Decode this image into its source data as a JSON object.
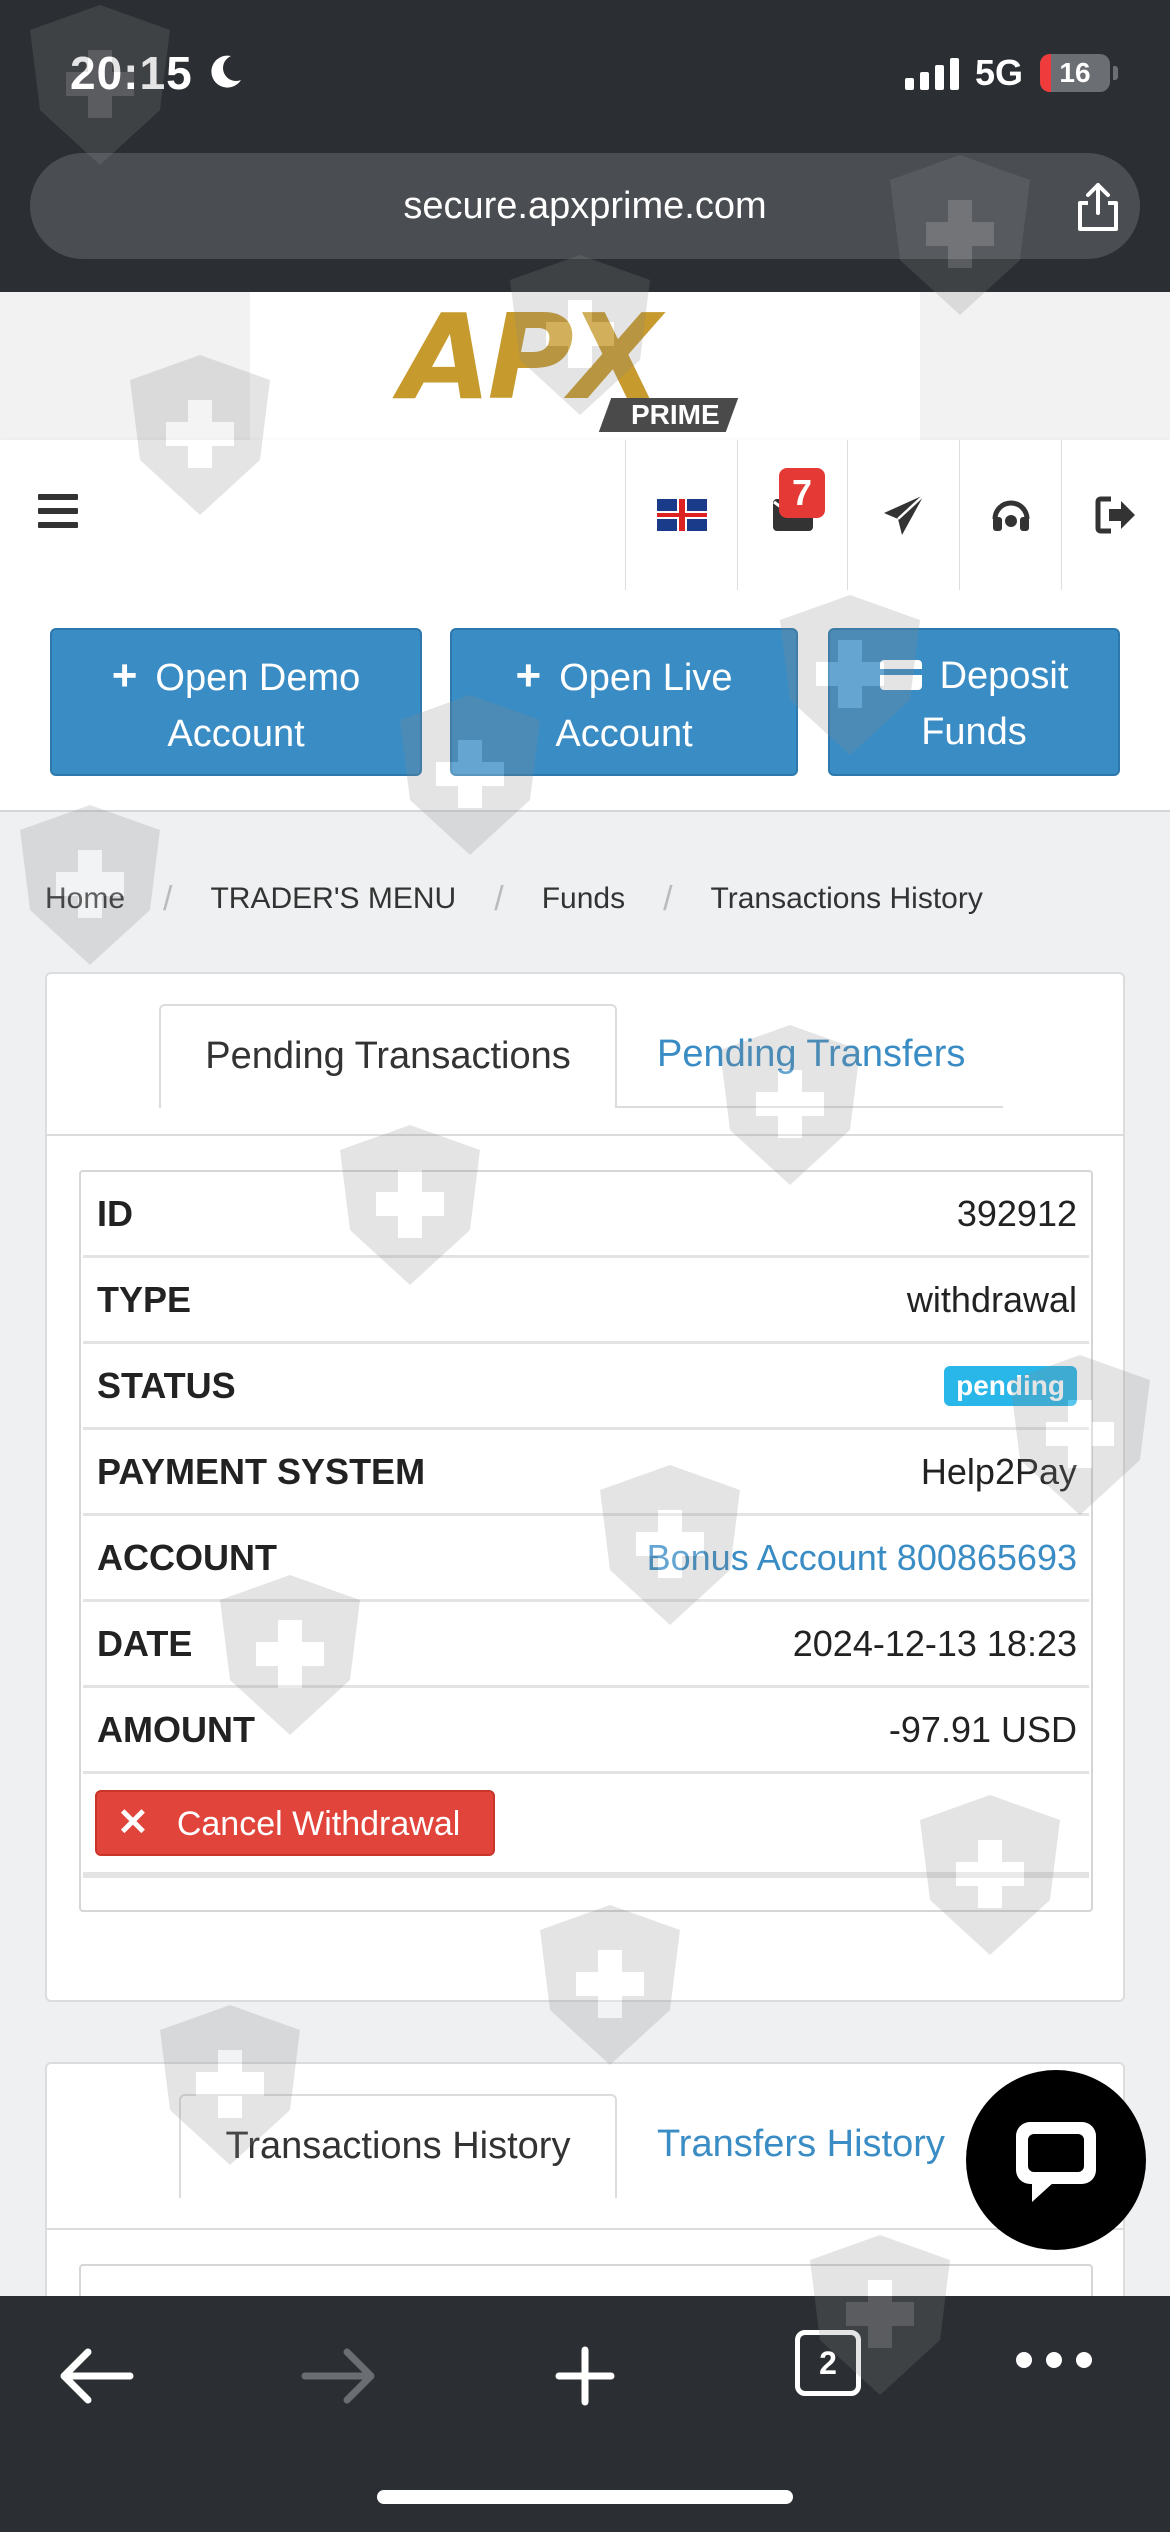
{
  "status_bar": {
    "time": "20:15",
    "network": "5G",
    "battery": "16",
    "battery_level": 0.16
  },
  "browser": {
    "url": "secure.apxprime.com",
    "tab_count": "2"
  },
  "brand": {
    "logo_text": "APX",
    "logo_sub": "PRIME",
    "logo_color": "#c69a2d"
  },
  "nav": {
    "notification_count": "7",
    "icons": [
      "menu-icon",
      "uk-flag-icon",
      "envelope-icon",
      "paper-plane-icon",
      "headset-icon",
      "logout-icon"
    ]
  },
  "actions": {
    "open_demo": "Open Demo Account",
    "open_live": "Open Live Account",
    "deposit": "Deposit Funds"
  },
  "breadcrumb": {
    "home": "Home",
    "menu": "TRADER'S MENU",
    "funds": "Funds",
    "current": "Transactions History"
  },
  "pending_panel": {
    "tab_active": "Pending Transactions",
    "tab_other": "Pending Transfers",
    "rows": [
      {
        "key": "ID",
        "value": "392912"
      },
      {
        "key": "TYPE",
        "value": "withdrawal"
      },
      {
        "key": "STATUS",
        "value": "pending"
      },
      {
        "key": "PAYMENT SYSTEM",
        "value": "Help2Pay"
      },
      {
        "key": "ACCOUNT",
        "value": "Bonus Account 800865693"
      },
      {
        "key": "DATE",
        "value": "2024-12-13 18:23"
      },
      {
        "key": "AMOUNT",
        "value": "-97.91 USD"
      }
    ],
    "cancel_label": "Cancel Withdrawal"
  },
  "history_panel": {
    "tab_active": "Transactions History",
    "tab_other": "Transfers History"
  },
  "colors": {
    "primary": "#3a8cc4",
    "danger": "#e0443a",
    "status_pending": "#29b6e8",
    "browser_chrome": "#2b2e33"
  }
}
